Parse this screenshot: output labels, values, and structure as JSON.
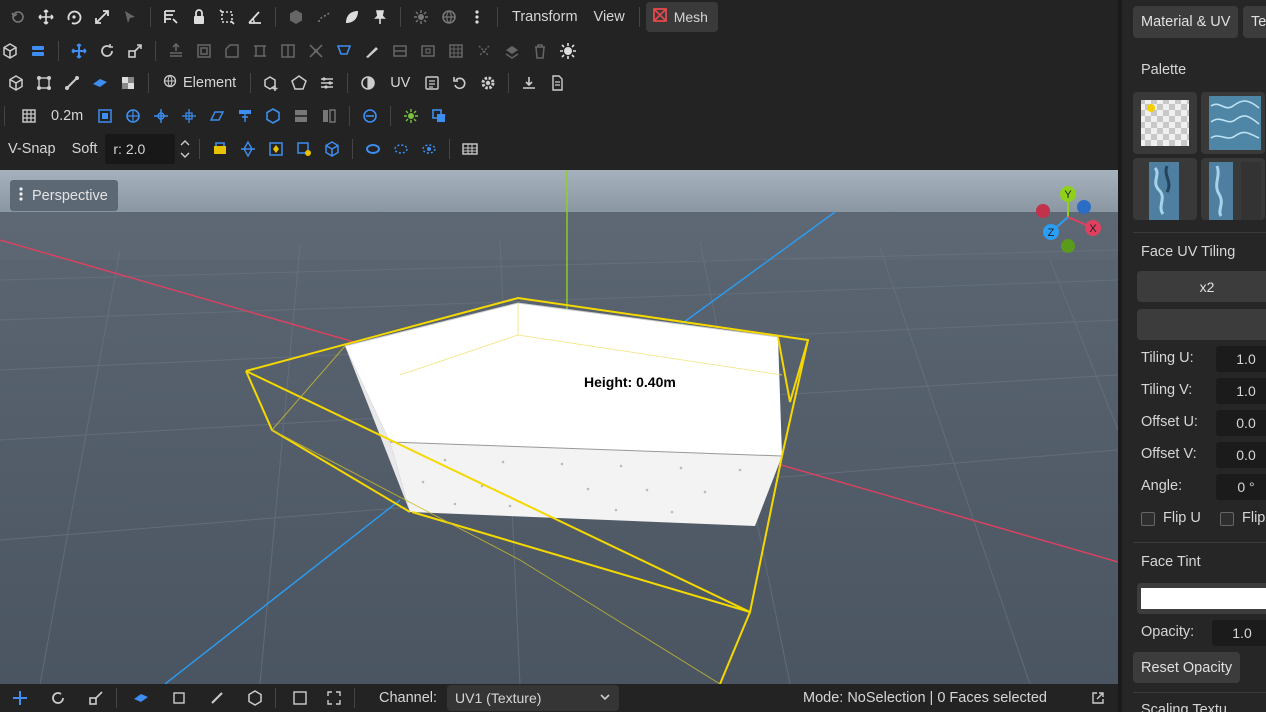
{
  "top_menu": {
    "transform": "Transform",
    "view": "View",
    "mesh": "Mesh"
  },
  "toolbar": {
    "element": "Element",
    "uv": "UV",
    "grid_size": "0.2m",
    "vsnap": "V-Snap",
    "soft": "Soft",
    "radius": "r: 2.0"
  },
  "viewport": {
    "mode": "Perspective",
    "height_label": "Height: 0.40m",
    "gizmo": {
      "y": "Y",
      "x": "X",
      "z": "Z"
    },
    "colors": {
      "sky": "#9aa7b3",
      "ground": "#4f5a66",
      "selection": "#f5d800",
      "axis_x": "#e04060",
      "axis_z": "#2a9df4",
      "axis_y": "#8fd11a"
    }
  },
  "bottom": {
    "channel_label": "Channel:",
    "channel_value": "UV1 (Texture)",
    "status": "Mode: NoSelection | 0 Faces selected"
  },
  "panel": {
    "tab_material": "Material & UV",
    "tab_texture": "Te",
    "palette": "Palette",
    "face_uv_tiling": "Face UV Tiling",
    "x2": "x2",
    "tiling_u_label": "Tiling U:",
    "tiling_u": "1.0",
    "tiling_v_label": "Tiling V:",
    "tiling_v": "1.0",
    "offset_u_label": "Offset U:",
    "offset_u": "0.0",
    "offset_v_label": "Offset V:",
    "offset_v": "0.0",
    "angle_label": "Angle:",
    "angle": "0 °",
    "flip_u": "Flip U",
    "flip_v": "Flip",
    "face_tint": "Face Tint",
    "tint_color": "#ffffff",
    "opacity_label": "Opacity:",
    "opacity": "1.0",
    "reset_opacity": "Reset Opacity",
    "scaling": "Scaling Textu"
  }
}
